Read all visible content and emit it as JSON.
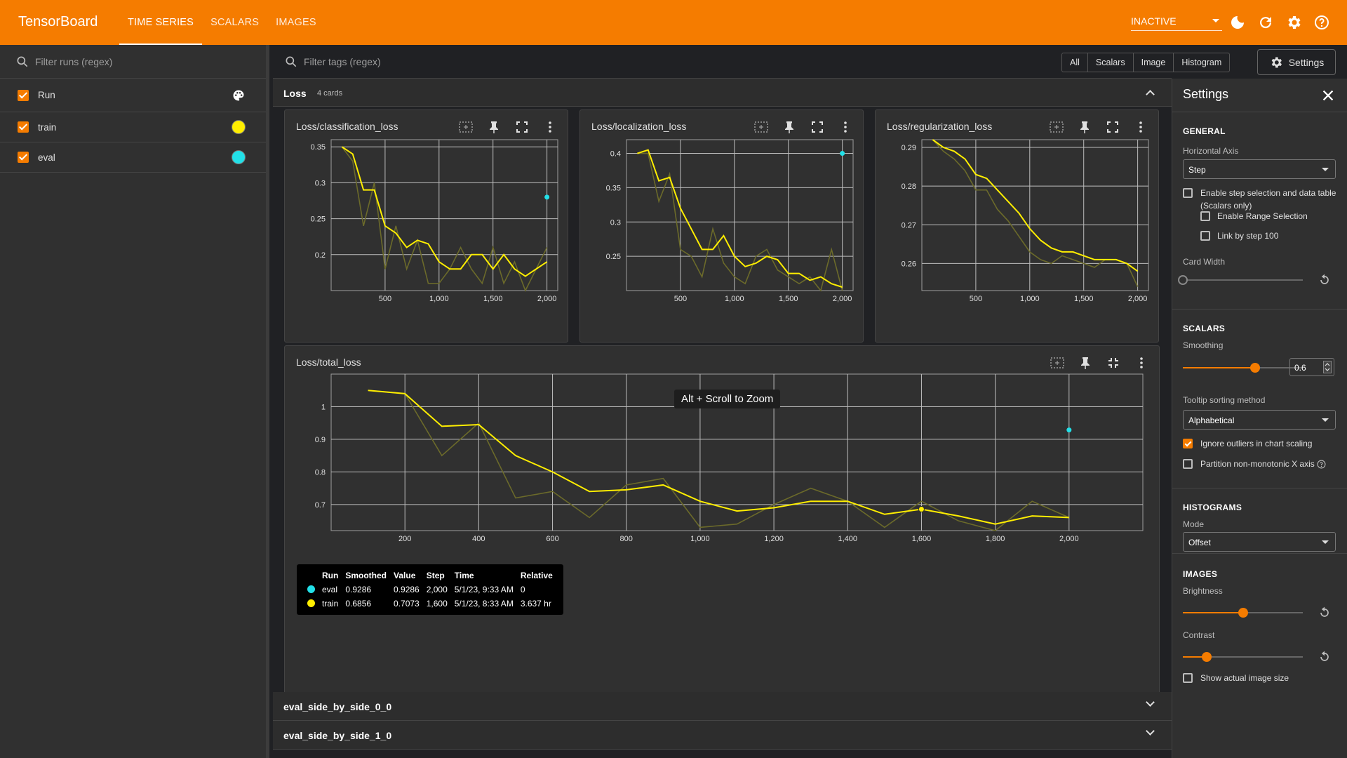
{
  "app": {
    "brand": "TensorBoard",
    "tabs": [
      "TIME SERIES",
      "SCALARS",
      "IMAGES"
    ],
    "status": "INACTIVE",
    "icons": [
      "dark-mode-icon",
      "refresh-icon",
      "gear-icon",
      "help-icon"
    ],
    "accent": "#f57c00"
  },
  "sidebar": {
    "filter_placeholder": "Filter runs (regex)",
    "header_label": "Run",
    "runs": [
      {
        "name": "train",
        "color": "#ffee00"
      },
      {
        "name": "eval",
        "color": "#22e0e8"
      }
    ]
  },
  "main": {
    "filter_placeholder": "Filter tags (regex)",
    "type_filters": [
      "All",
      "Scalars",
      "Image",
      "Histogram"
    ],
    "settings_label": "Settings",
    "group": {
      "title": "Loss",
      "count": "4 cards"
    },
    "collapsed_groups": [
      "eval_side_by_side_0_0",
      "eval_side_by_side_1_0"
    ],
    "zoom_tip": "Alt + Scroll to Zoom",
    "tooltip": {
      "headers": [
        "Run",
        "Smoothed",
        "Value",
        "Step",
        "Time",
        "Relative"
      ],
      "rows": [
        {
          "run": "eval",
          "smoothed": "0.9286",
          "value": "0.9286",
          "step": "2,000",
          "time": "5/1/23, 9:33 AM",
          "relative": "0"
        },
        {
          "run": "train",
          "smoothed": "0.6856",
          "value": "0.7073",
          "step": "1,600",
          "time": "5/1/23, 8:33 AM",
          "relative": "3.637 hr"
        }
      ]
    }
  },
  "chart_data": [
    {
      "type": "line",
      "title": "Loss/classification_loss",
      "xlim": [
        0,
        2100
      ],
      "ylim": [
        0.15,
        0.36
      ],
      "xticks": [
        500,
        1000,
        1500,
        2000
      ],
      "xtick_labels": [
        "500",
        "1,000",
        "1,500",
        "2,000"
      ],
      "yticks": [
        0.2,
        0.25,
        0.3,
        0.35
      ],
      "ytick_labels": [
        "0.2",
        "0.25",
        "0.3",
        "0.35"
      ],
      "series": [
        {
          "name": "train",
          "x": [
            100,
            200,
            300,
            400,
            500,
            600,
            700,
            800,
            900,
            1000,
            1100,
            1200,
            1300,
            1400,
            1500,
            1600,
            1700,
            1800,
            1900,
            2000
          ],
          "raw": [
            0.35,
            0.33,
            0.24,
            0.3,
            0.18,
            0.24,
            0.18,
            0.22,
            0.16,
            0.16,
            0.18,
            0.21,
            0.18,
            0.16,
            0.21,
            0.16,
            0.19,
            0.15,
            0.18,
            0.21
          ],
          "smoothed": [
            0.35,
            0.34,
            0.29,
            0.29,
            0.24,
            0.23,
            0.21,
            0.22,
            0.215,
            0.19,
            0.18,
            0.18,
            0.2,
            0.2,
            0.18,
            0.2,
            0.18,
            0.17,
            0.18,
            0.19
          ]
        },
        {
          "name": "eval",
          "x": [
            2000
          ],
          "raw": [
            0.28
          ],
          "smoothed": [
            0.28
          ]
        }
      ]
    },
    {
      "type": "line",
      "title": "Loss/localization_loss",
      "xlim": [
        0,
        2100
      ],
      "ylim": [
        0.2,
        0.42
      ],
      "xticks": [
        500,
        1000,
        1500,
        2000
      ],
      "xtick_labels": [
        "500",
        "1,000",
        "1,500",
        "2,000"
      ],
      "yticks": [
        0.25,
        0.3,
        0.35,
        0.4
      ],
      "ytick_labels": [
        "0.25",
        "0.3",
        "0.35",
        "0.4"
      ],
      "series": [
        {
          "name": "train",
          "x": [
            100,
            200,
            300,
            400,
            500,
            600,
            700,
            800,
            900,
            1000,
            1100,
            1200,
            1300,
            1400,
            1500,
            1600,
            1700,
            1800,
            1900,
            2000
          ],
          "raw": [
            0.4,
            0.4,
            0.33,
            0.37,
            0.26,
            0.25,
            0.22,
            0.29,
            0.24,
            0.22,
            0.21,
            0.25,
            0.26,
            0.23,
            0.22,
            0.21,
            0.22,
            0.2,
            0.26,
            0.2
          ],
          "smoothed": [
            0.4,
            0.405,
            0.36,
            0.365,
            0.32,
            0.29,
            0.26,
            0.26,
            0.28,
            0.25,
            0.235,
            0.24,
            0.25,
            0.245,
            0.225,
            0.225,
            0.215,
            0.22,
            0.21,
            0.205
          ]
        },
        {
          "name": "eval",
          "x": [
            2000
          ],
          "raw": [
            0.4
          ],
          "smoothed": [
            0.4
          ]
        }
      ]
    },
    {
      "type": "line",
      "title": "Loss/regularization_loss",
      "xlim": [
        0,
        2100
      ],
      "ylim": [
        0.253,
        0.292
      ],
      "xticks": [
        500,
        1000,
        1500,
        2000
      ],
      "xtick_labels": [
        "500",
        "1,000",
        "1,500",
        "2,000"
      ],
      "yticks": [
        0.26,
        0.27,
        0.28,
        0.29
      ],
      "ytick_labels": [
        "0.26",
        "0.27",
        "0.28",
        "0.29"
      ],
      "series": [
        {
          "name": "train",
          "x": [
            100,
            200,
            300,
            400,
            500,
            600,
            700,
            800,
            900,
            1000,
            1100,
            1200,
            1300,
            1400,
            1500,
            1600,
            1700,
            1800,
            1900,
            2000
          ],
          "raw": [
            0.292,
            0.289,
            0.287,
            0.284,
            0.279,
            0.279,
            0.274,
            0.271,
            0.267,
            0.263,
            0.261,
            0.26,
            0.262,
            0.261,
            0.26,
            0.259,
            0.261,
            0.261,
            0.26,
            0.254
          ],
          "smoothed": [
            0.292,
            0.29,
            0.289,
            0.287,
            0.283,
            0.282,
            0.279,
            0.276,
            0.273,
            0.269,
            0.266,
            0.264,
            0.263,
            0.263,
            0.262,
            0.261,
            0.261,
            0.261,
            0.26,
            0.258
          ]
        }
      ]
    },
    {
      "type": "line",
      "title": "Loss/total_loss",
      "xlim": [
        0,
        2200
      ],
      "ylim": [
        0.62,
        1.1
      ],
      "xticks": [
        200,
        400,
        600,
        800,
        1000,
        1200,
        1400,
        1600,
        1800,
        2000
      ],
      "xtick_labels": [
        "200",
        "400",
        "600",
        "800",
        "1,000",
        "1,200",
        "1,400",
        "1,600",
        "1,800",
        "2,000"
      ],
      "yticks": [
        0.7,
        0.8,
        0.9,
        1
      ],
      "ytick_labels": [
        "0.7",
        "0.8",
        "0.9",
        "1"
      ],
      "series": [
        {
          "name": "train",
          "x": [
            100,
            200,
            300,
            400,
            500,
            600,
            700,
            800,
            900,
            1000,
            1100,
            1200,
            1300,
            1400,
            1500,
            1600,
            1700,
            1800,
            1900,
            2000
          ],
          "raw": [
            1.05,
            1.04,
            0.85,
            0.95,
            0.72,
            0.74,
            0.66,
            0.76,
            0.78,
            0.63,
            0.64,
            0.7,
            0.75,
            0.71,
            0.63,
            0.71,
            0.65,
            0.62,
            0.71,
            0.66
          ],
          "smoothed": [
            1.05,
            1.04,
            0.94,
            0.945,
            0.85,
            0.8,
            0.74,
            0.745,
            0.76,
            0.71,
            0.68,
            0.69,
            0.71,
            0.71,
            0.67,
            0.6856,
            0.665,
            0.64,
            0.665,
            0.66
          ]
        },
        {
          "name": "eval",
          "x": [
            2000
          ],
          "raw": [
            0.9286
          ],
          "smoothed": [
            0.9286
          ]
        }
      ]
    }
  ],
  "settings": {
    "title": "Settings",
    "general": {
      "heading": "GENERAL",
      "axis_label": "Horizontal Axis",
      "axis_value": "Step",
      "step_selection": "Enable step selection and data table",
      "step_selection_note": "(Scalars only)",
      "range_selection": "Enable Range Selection",
      "link_by_step": "Link by step 100",
      "card_width_label": "Card Width",
      "card_width": 0
    },
    "scalars": {
      "heading": "SCALARS",
      "smoothing_label": "Smoothing",
      "smoothing": 0.6,
      "smoothing_text": "0.6",
      "tooltip_sort_label": "Tooltip sorting method",
      "tooltip_sort_value": "Alphabetical",
      "ignore_outliers": "Ignore outliers in chart scaling",
      "partition": "Partition non-monotonic X axis"
    },
    "histograms": {
      "heading": "HISTOGRAMS",
      "mode_label": "Mode",
      "mode_value": "Offset"
    },
    "images": {
      "heading": "IMAGES",
      "brightness_label": "Brightness",
      "brightness": 0.5,
      "contrast_label": "Contrast",
      "contrast": 0.2,
      "actual_size": "Show actual image size"
    }
  }
}
